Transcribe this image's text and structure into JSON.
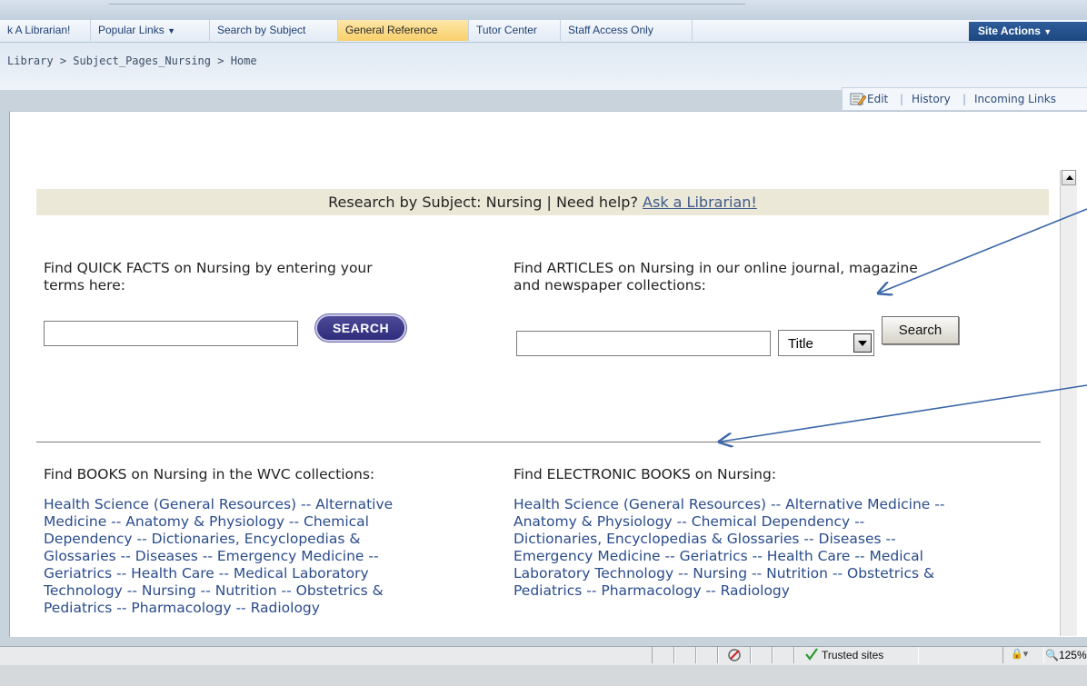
{
  "nav": {
    "items": [
      {
        "label": "k A Librarian!",
        "active": false
      },
      {
        "label": "Popular Links",
        "active": false,
        "dropdown": true
      },
      {
        "label": "Search by Subject",
        "active": false
      },
      {
        "label": "General Reference",
        "active": true
      },
      {
        "label": "Tutor Center",
        "active": false
      },
      {
        "label": "Staff Access Only",
        "active": false
      }
    ],
    "site_actions": "Site Actions"
  },
  "breadcrumb": {
    "items": [
      "Library",
      "Subject_Pages_Nursing",
      "Home"
    ],
    "separator": ">"
  },
  "actions": {
    "edit": "Edit",
    "history": "History",
    "incoming_links": "Incoming Links"
  },
  "banner": {
    "text": "Research by Subject: Nursing | Need help?",
    "link": "Ask a Librarian!"
  },
  "quick_facts": {
    "label_line1": "Find QUICK FACTS on Nursing by entering your",
    "label_line2": "terms here:",
    "search_value": "",
    "button": "SEARCH"
  },
  "articles": {
    "label_line1": "Find ARTICLES on Nursing in our online journal, magazine",
    "label_line2": "and newspaper collections:",
    "search_value": "",
    "select_value": "Title",
    "button": "Search"
  },
  "books": {
    "label": "Find BOOKS on Nursing in the WVC collections:",
    "lines": [
      "Health Science (General Resources) -- Alternative",
      "Medicine -- Anatomy & Physiology -- Chemical",
      "Dependency -- Dictionaries, Encyclopedias &",
      "Glossaries -- Diseases -- Emergency Medicine --",
      "Geriatrics -- Health Care -- Medical Laboratory",
      "Technology -- Nursing -- Nutrition -- Obstetrics &",
      "Pediatrics -- Pharmacology -- Radiology"
    ]
  },
  "ebooks": {
    "label": "Find ELECTRONIC BOOKS on Nursing:",
    "lines": [
      "Health Science (General Resources) -- Alternative Medicine --",
      "Anatomy & Physiology -- Chemical Dependency --",
      "Dictionaries, Encyclopedias & Glossaries -- Diseases --",
      "Emergency Medicine -- Geriatrics -- Health Care -- Medical",
      "Laboratory Technology -- Nursing -- Nutrition -- Obstetrics &",
      "Pediatrics -- Pharmacology -- Radiology"
    ]
  },
  "status": {
    "zone": "Trusted sites",
    "zoom": "125%"
  },
  "colors": {
    "link": "#2a4c8c",
    "banner_bg": "#ebe8d8",
    "site_actions_bg": "#1d4780",
    "arrow": "#3a66a8"
  }
}
